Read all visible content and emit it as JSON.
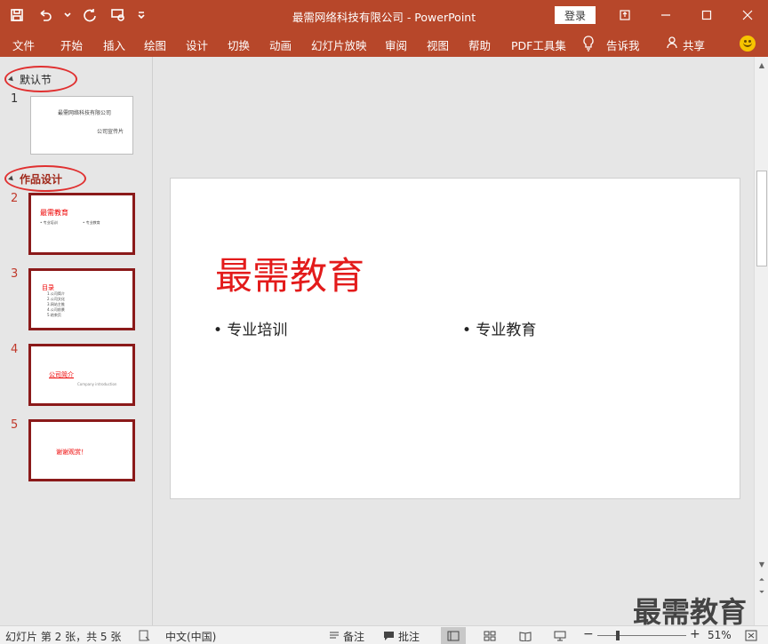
{
  "window": {
    "title": "最需网络科技有限公司  -  PowerPoint",
    "login_label": "登录"
  },
  "ribbon": {
    "tabs": [
      "文件",
      "开始",
      "插入",
      "绘图",
      "设计",
      "切换",
      "动画",
      "幻灯片放映",
      "审阅",
      "视图",
      "帮助",
      "PDF工具集"
    ],
    "tell_me": "告诉我",
    "share": "共享"
  },
  "thumbnails": {
    "sections": [
      {
        "name": "默认节"
      },
      {
        "name": "作品设计"
      }
    ],
    "slides": [
      {
        "num": "1",
        "line1": "最需网络科技有限公司",
        "line2": "公司宣传片"
      },
      {
        "num": "2",
        "title": "最需教育",
        "b1": "• 专业培训",
        "b2": "• 专业教育"
      },
      {
        "num": "3",
        "title": "目录",
        "items": [
          "1.公司简介",
          "2.公司文化",
          "3.网站主推",
          "4.公司前景",
          "5.结束页"
        ]
      },
      {
        "num": "4",
        "title": "公司简介",
        "sub": "Company introduction"
      },
      {
        "num": "5",
        "title": "谢谢观赏！"
      }
    ]
  },
  "slide": {
    "title": "最需教育",
    "bullet_left": "• 专业培训",
    "bullet_right": "• 专业教育"
  },
  "status": {
    "slide_info": "幻灯片 第 2 张，共 5 张",
    "language": "中文(中国)",
    "notes": "备注",
    "comments": "批注",
    "zoom": "51%",
    "zoom_value": 51
  },
  "watermark": "最需教育",
  "colors": {
    "accent": "#b7472a",
    "title_red": "#e31b1b",
    "selected_border": "#8b1a1a"
  }
}
